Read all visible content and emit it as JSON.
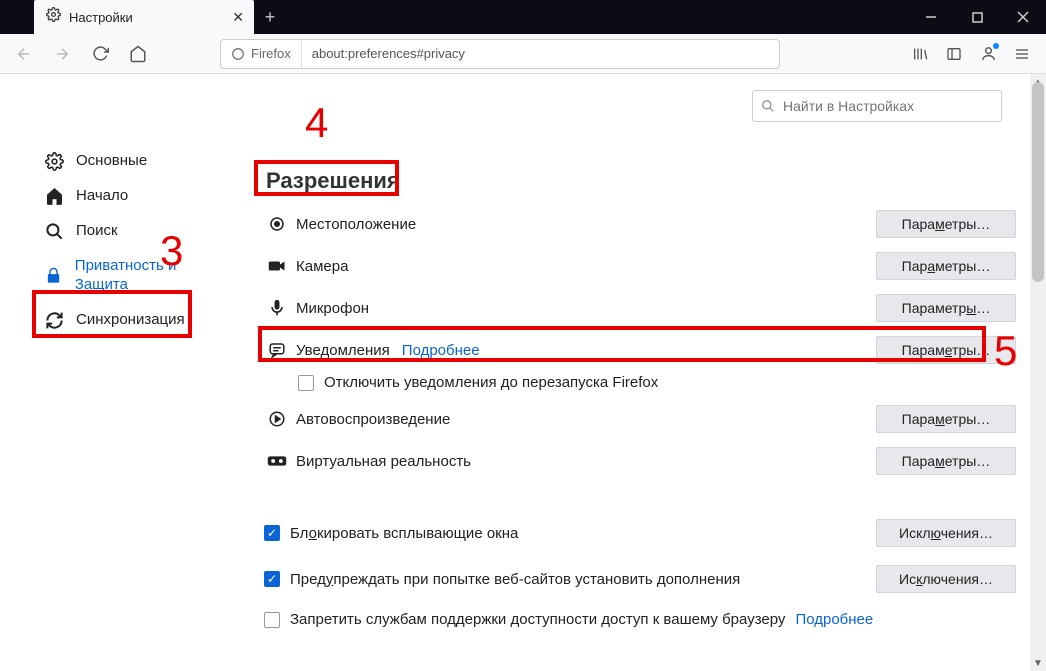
{
  "titlebar": {
    "tab_title": "Настройки"
  },
  "toolbar": {
    "identity_label": "Firefox",
    "url": "about:preferences#privacy"
  },
  "search": {
    "placeholder": "Найти в Настройках"
  },
  "sidebar": {
    "items": [
      {
        "label": "Основные"
      },
      {
        "label": "Начало"
      },
      {
        "label": "Поиск"
      },
      {
        "label": "Приватность и Защита"
      },
      {
        "label": "Синхронизация"
      }
    ]
  },
  "main": {
    "section_title": "Разрешения",
    "permissions": [
      {
        "label": "Местоположение",
        "button": "Параметры…",
        "u": "м"
      },
      {
        "label": "Камера",
        "button": "Параметры…",
        "u": "а"
      },
      {
        "label": "Микрофон",
        "button": "Параметры…",
        "u": "ы"
      },
      {
        "label": "Уведомления",
        "link": "Подробнее",
        "button": "Параметры…",
        "u": "е",
        "sub": "Отключить уведомления до перезапуска Firefox"
      },
      {
        "label": "Автовоспроизведение",
        "button": "Параметры…",
        "u": "м"
      },
      {
        "label": "Виртуальная реальность",
        "button": "Параметры…",
        "u": "м"
      }
    ],
    "checks": [
      {
        "label_pre": "Бл",
        "u": "о",
        "label_post": "кировать всплывающие окна",
        "checked": true,
        "button": "Исключения…",
        "bu": "ю"
      },
      {
        "label_pre": "Пред",
        "u": "у",
        "label_post": "преждать при попытке веб-сайтов установить дополнения",
        "checked": true,
        "button": "Исключения…",
        "bu": "к"
      },
      {
        "label_pre": "Запретить службам поддержки доступности доступ к вашему браузеру",
        "u": "",
        "label_post": "",
        "checked": false,
        "link": "Подробнее"
      }
    ]
  },
  "annotations": {
    "n3": "3",
    "n4": "4",
    "n5": "5"
  }
}
